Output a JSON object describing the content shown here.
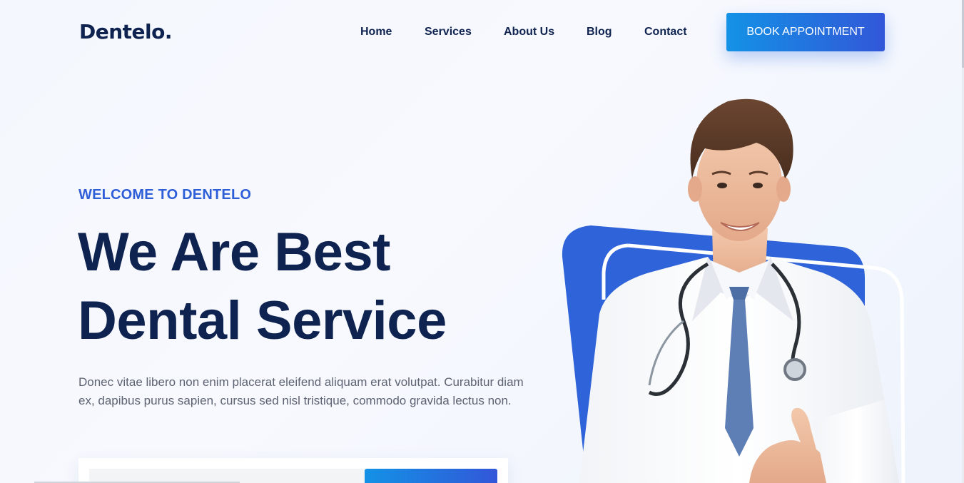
{
  "header": {
    "logo": "Dentelo.",
    "nav": [
      {
        "label": "Home"
      },
      {
        "label": "Services"
      },
      {
        "label": "About Us"
      },
      {
        "label": "Blog"
      },
      {
        "label": "Contact"
      }
    ],
    "cta_label": "BOOK APPOINTMENT"
  },
  "hero": {
    "eyebrow": "WELCOME TO DENTELO",
    "title_line1": "We Are Best",
    "title_line2": "Dental Service",
    "description": "Donec vitae libero non enim placerat eleifend aliquam erat volutpat. Curabitur diam ex, dapibus purus sapien, cursus sed nisl tristique, commodo gravida lectus non."
  },
  "colors": {
    "brand_navy": "#0f2350",
    "accent_blue": "#2f5fd8",
    "button_gradient_start": "#1392e6",
    "button_gradient_end": "#3257d8"
  },
  "icons": {
    "hero_image": "doctor-portrait"
  }
}
